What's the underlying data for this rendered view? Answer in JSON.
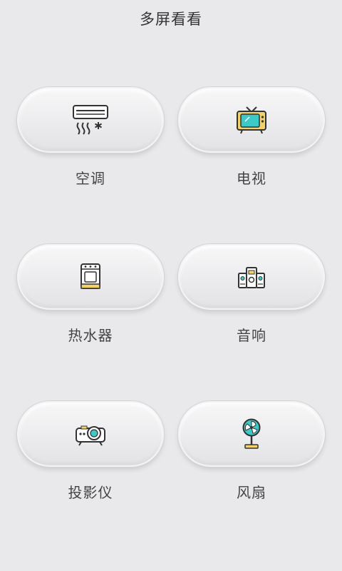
{
  "header": {
    "title": "多屏看看"
  },
  "devices": [
    {
      "label": "空调",
      "icon": "air-conditioner-icon"
    },
    {
      "label": "电视",
      "icon": "tv-icon"
    },
    {
      "label": "热水器",
      "icon": "water-heater-icon"
    },
    {
      "label": "音响",
      "icon": "speaker-icon"
    },
    {
      "label": "投影仪",
      "icon": "projector-icon"
    },
    {
      "label": "风扇",
      "icon": "fan-icon"
    }
  ],
  "colors": {
    "background": "#e9e9eb",
    "icon_stroke": "#333333",
    "icon_accent_teal": "#3ec9c9",
    "icon_accent_yellow": "#f2d36b"
  }
}
